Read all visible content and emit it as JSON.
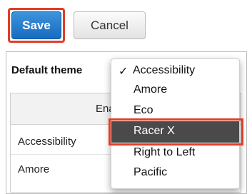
{
  "toolbar": {
    "save_label": "Save",
    "cancel_label": "Cancel"
  },
  "settings": {
    "default_theme_label": "Default theme",
    "table": {
      "column_header": "Enab",
      "rows": [
        "Accessibility",
        "Amore"
      ]
    }
  },
  "dropdown": {
    "selected_mark": "✓",
    "items": [
      "Accessibility",
      "Amore",
      "Eco",
      "Racer X",
      "Right to Left",
      "Pacific"
    ],
    "highlighted_index": 3
  },
  "colors": {
    "primary": "#1b6fc2",
    "highlight_outline": "#e23d27",
    "menu_highlight": "#4a4a4a"
  }
}
